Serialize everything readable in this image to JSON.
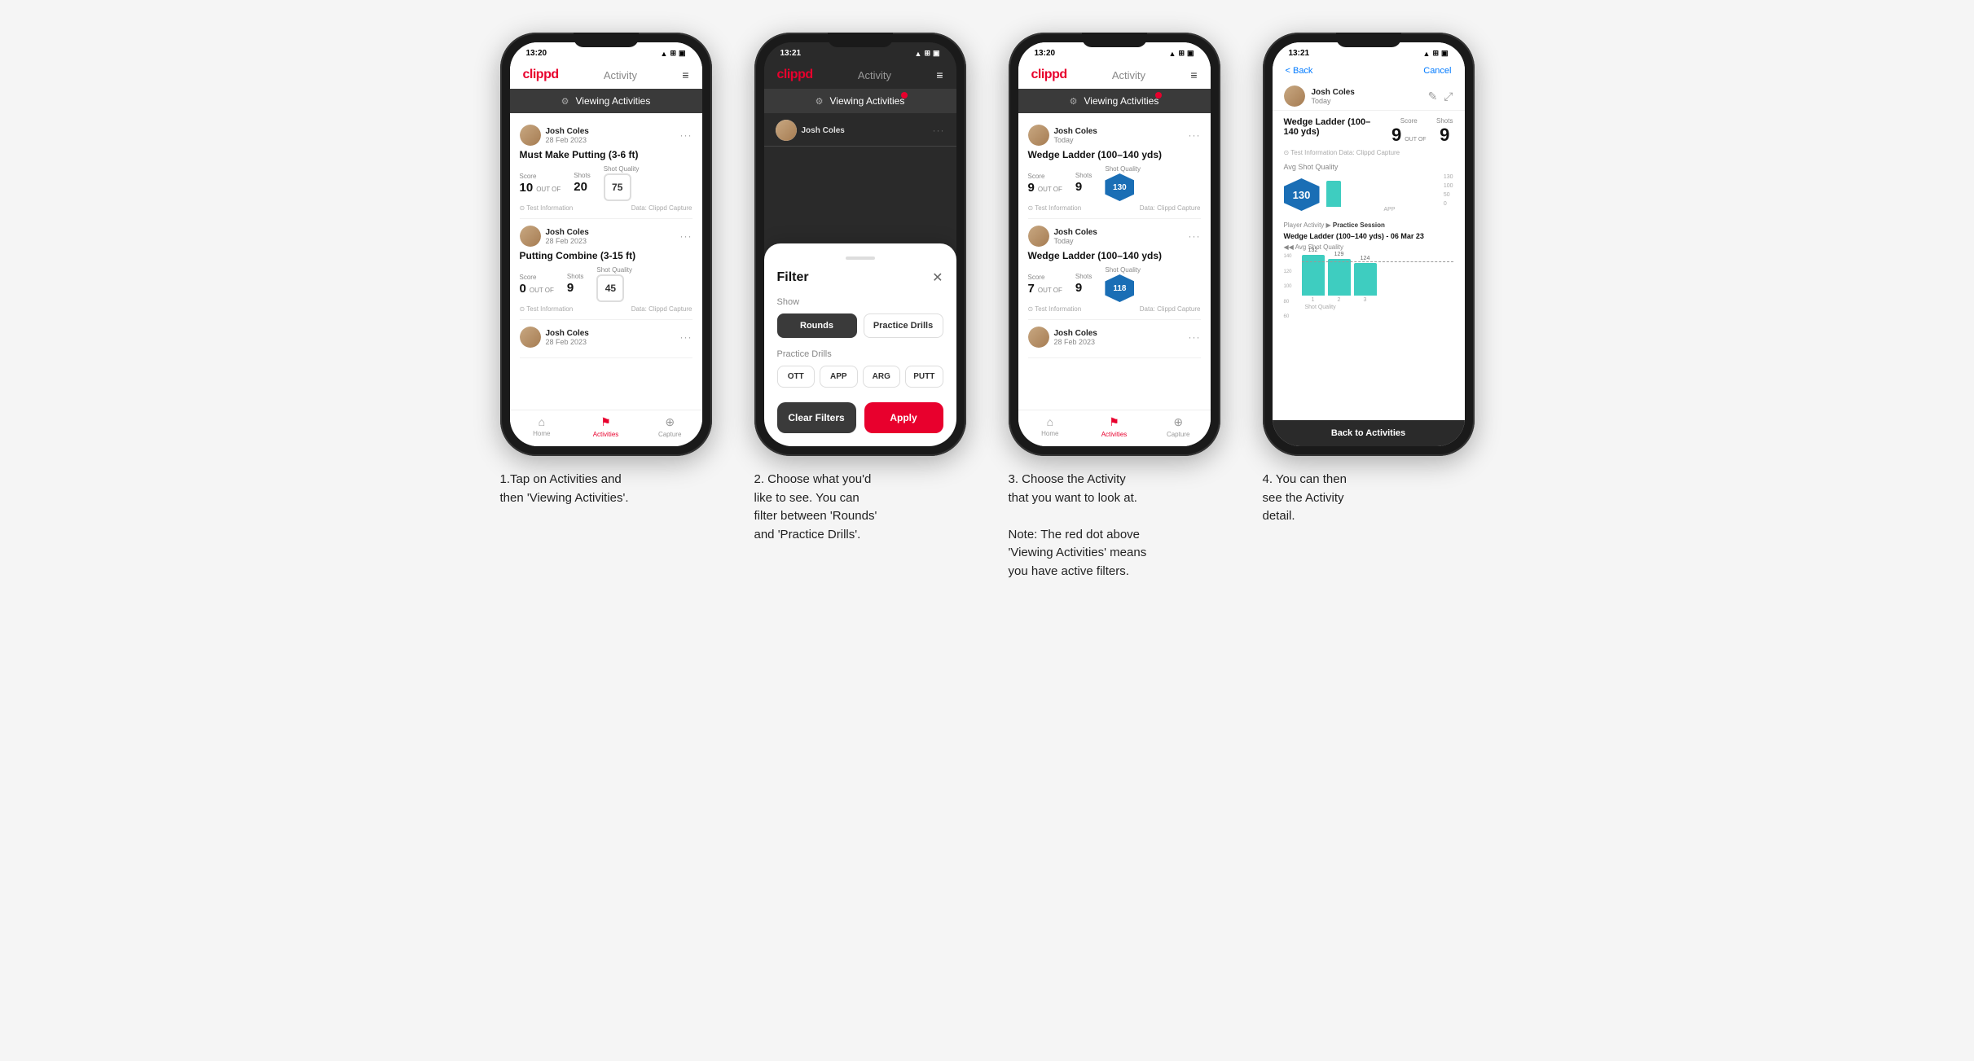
{
  "phones": [
    {
      "id": "phone1",
      "statusBar": {
        "time": "13:20",
        "icons": "▲ ⊞ ▣"
      },
      "nav": {
        "logo": "clippd",
        "title": "Activity",
        "menu": "≡"
      },
      "banner": {
        "text": "Viewing Activities",
        "hasRedDot": false
      },
      "cards": [
        {
          "user": "Josh Coles",
          "date": "28 Feb 2023",
          "title": "Must Make Putting (3-6 ft)",
          "scorelabel": "Score",
          "shotslabel": "Shots",
          "qualitylabel": "Shot Quality",
          "score": "10",
          "outof": "OUT OF",
          "shots": "20",
          "quality": "75",
          "footerLeft": "⊙ Test Information",
          "footerRight": "Data: Clippd Capture"
        },
        {
          "user": "Josh Coles",
          "date": "28 Feb 2023",
          "title": "Putting Combine (3-15 ft)",
          "scorelabel": "Score",
          "shotslabel": "Shots",
          "qualitylabel": "Shot Quality",
          "score": "0",
          "outof": "OUT OF",
          "shots": "9",
          "quality": "45",
          "footerLeft": "⊙ Test Information",
          "footerRight": "Data: Clippd Capture"
        },
        {
          "user": "Josh Coles",
          "date": "28 Feb 2023",
          "title": "",
          "partial": true
        }
      ],
      "bottomNav": [
        {
          "icon": "⌂",
          "label": "Home",
          "active": false
        },
        {
          "icon": "♪",
          "label": "Activities",
          "active": true
        },
        {
          "icon": "⊕",
          "label": "Capture",
          "active": false
        }
      ]
    },
    {
      "id": "phone2",
      "statusBar": {
        "time": "13:21",
        "icons": "▲ ⊞ ▣"
      },
      "nav": {
        "logo": "clippd",
        "title": "Activity",
        "menu": "≡"
      },
      "banner": {
        "text": "Viewing Activities",
        "hasRedDot": true
      },
      "filter": {
        "title": "Filter",
        "showLabel": "Show",
        "showOptions": [
          "Rounds",
          "Practice Drills"
        ],
        "selectedShow": "Rounds",
        "drillsLabel": "Practice Drills",
        "drillOptions": [
          "OTT",
          "APP",
          "ARG",
          "PUTT"
        ],
        "clearLabel": "Clear Filters",
        "applyLabel": "Apply"
      }
    },
    {
      "id": "phone3",
      "statusBar": {
        "time": "13:20",
        "icons": "▲ ⊞ ▣"
      },
      "nav": {
        "logo": "clippd",
        "title": "Activity",
        "menu": "≡"
      },
      "banner": {
        "text": "Viewing Activities",
        "hasRedDot": true
      },
      "cards": [
        {
          "user": "Josh Coles",
          "date": "Today",
          "title": "Wedge Ladder (100–140 yds)",
          "scorelabel": "Score",
          "shotslabel": "Shots",
          "qualitylabel": "Shot Quality",
          "score": "9",
          "outof": "OUT OF",
          "shots": "9",
          "quality": "130",
          "qualityHex": true,
          "footerLeft": "⊙ Test Information",
          "footerRight": "Data: Clippd Capture"
        },
        {
          "user": "Josh Coles",
          "date": "Today",
          "title": "Wedge Ladder (100–140 yds)",
          "scorelabel": "Score",
          "shotslabel": "Shots",
          "qualitylabel": "Shot Quality",
          "score": "7",
          "outof": "OUT OF",
          "shots": "9",
          "quality": "118",
          "qualityHex": true,
          "footerLeft": "⊙ Test Information",
          "footerRight": "Data: Clippd Capture"
        },
        {
          "user": "Josh Coles",
          "date": "28 Feb 2023",
          "title": "",
          "partial": true
        }
      ],
      "bottomNav": [
        {
          "icon": "⌂",
          "label": "Home",
          "active": false
        },
        {
          "icon": "♪",
          "label": "Activities",
          "active": true
        },
        {
          "icon": "⊕",
          "label": "Capture",
          "active": false
        }
      ]
    },
    {
      "id": "phone4",
      "statusBar": {
        "time": "13:21",
        "icons": "▲ ⊞ ▣"
      },
      "backLabel": "< Back",
      "cancelLabel": "Cancel",
      "user": "Josh Coles",
      "userDate": "Today",
      "detailTitle": "Wedge Ladder (100–140 yds)",
      "scoreLabel": "Score",
      "shotsLabel": "Shots",
      "scoreValue": "9",
      "outOfLabel": "OUT OF",
      "shotsValue": "9",
      "infoLine": "⊙ Test Information    Data: Clippd Capture",
      "avgLabel": "Avg Shot Quality",
      "avgValue": "130",
      "chartBarLabel": "APP",
      "chartValues": [
        132,
        129,
        124
      ],
      "chartDash": 124,
      "playerActivityLabel": "Player Activity",
      "practiceLabel": "Practice Session",
      "practiceDrillTitle": "Wedge Ladder (100–140 yds) - 06 Mar 23",
      "avgShotQualityLabel": "◀◀ Avg Shot Quality",
      "backToActivities": "Back to Activities"
    }
  ],
  "captions": [
    "1.Tap on Activities and\nthen 'Viewing Activities'.",
    "2. Choose what you'd\nlike to see. You can\nfilter between 'Rounds'\nand 'Practice Drills'.",
    "3. Choose the Activity\nthat you want to look at.\n\nNote: The red dot above\n'Viewing Activities' means\nyou have active filters.",
    "4. You can then\nsee the Activity\ndetail."
  ]
}
